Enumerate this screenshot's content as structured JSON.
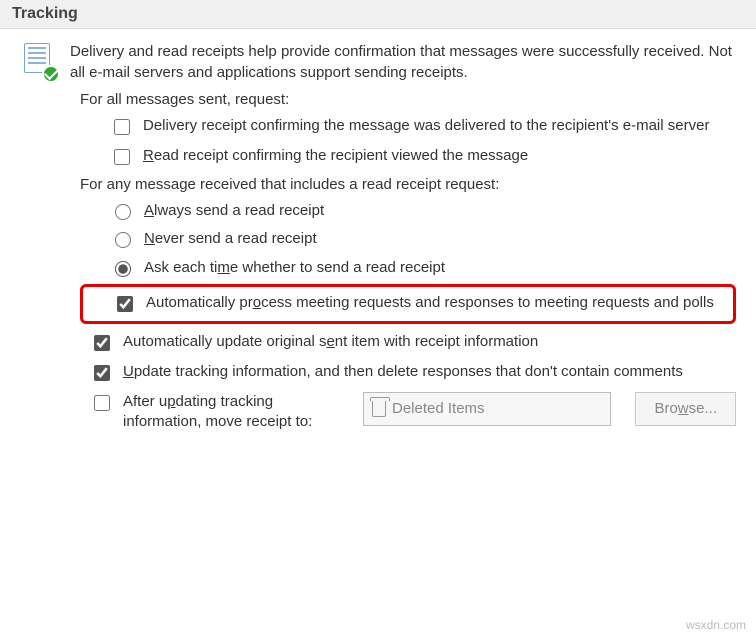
{
  "header": {
    "title": "Tracking"
  },
  "intro": "Delivery and read receipts help provide confirmation that messages were successfully received. Not all e-mail servers and applications support sending receipts.",
  "request_label": "For all messages sent, request:",
  "opt_delivery": "Delivery receipt confirming the message was delivered to the recipient's e-mail server",
  "opt_read": "Read receipt confirming the recipient viewed the message",
  "receive_label": "For any message received that includes a read receipt request:",
  "radio_always": "Always send a read receipt",
  "radio_never": "Never send a read receipt",
  "radio_ask": "Ask each time whether to send a read receipt",
  "chk_auto_process": "Automatically process meeting requests and responses to meeting requests and polls",
  "chk_auto_update": "Automatically update original sent item with receipt information",
  "chk_update_tracking": "Update tracking information, and then delete responses that don't contain comments",
  "chk_move_receipt": "After updating tracking information, move receipt to:",
  "folder_name": "Deleted Items",
  "browse_label": "Browse...",
  "watermark": "wsxdn.com"
}
